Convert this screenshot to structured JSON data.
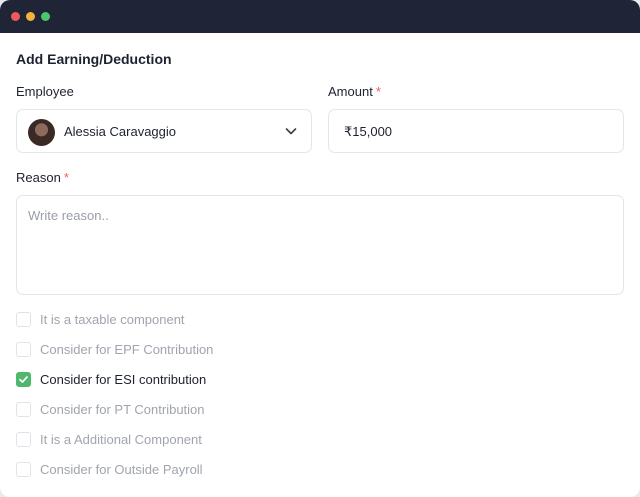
{
  "window": {
    "controls": [
      "close",
      "minimize",
      "maximize"
    ]
  },
  "form": {
    "title": "Add Earning/Deduction",
    "employee": {
      "label": "Employee",
      "selected_name": "Alessia Caravaggio",
      "icon": "chevron-down-icon"
    },
    "amount": {
      "label": "Amount",
      "required_mark": "*",
      "value": "₹15,000"
    },
    "reason": {
      "label": "Reason",
      "required_mark": "*",
      "placeholder": "Write reason.."
    },
    "options": [
      {
        "label": "It is a taxable component",
        "checked": false
      },
      {
        "label": "Consider for EPF Contribution",
        "checked": false
      },
      {
        "label": "Consider for ESI contribution",
        "checked": true
      },
      {
        "label": "Consider for PT Contribution",
        "checked": false
      },
      {
        "label": "It is a Additional Component",
        "checked": false
      },
      {
        "label": "Consider for Outside Payroll",
        "checked": false
      }
    ]
  },
  "colors": {
    "titlebar": "#1f2537",
    "accent_check": "#4fb86c",
    "required": "#ef5b5b"
  }
}
